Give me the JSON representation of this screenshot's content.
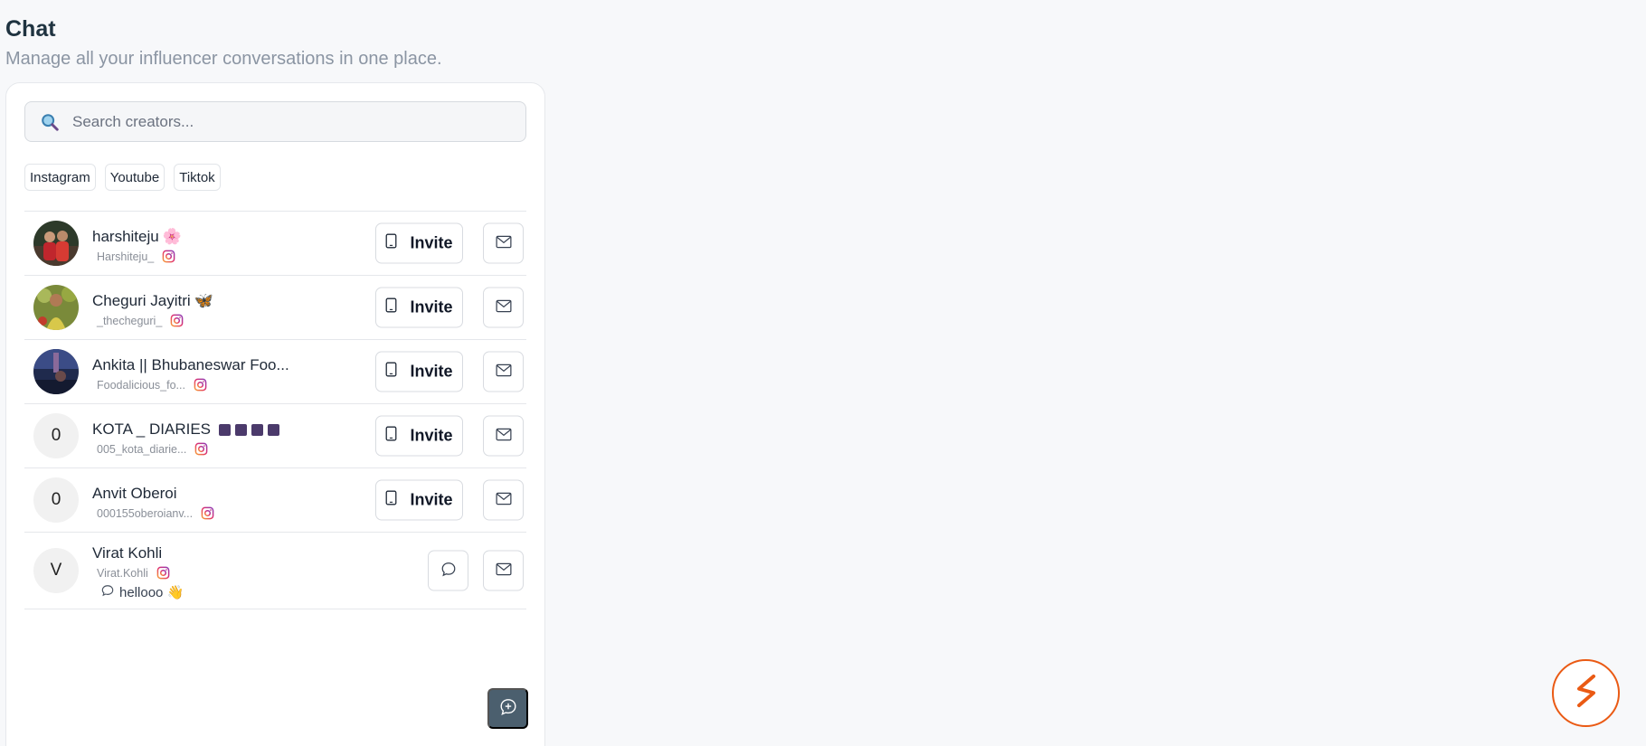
{
  "header": {
    "title": "Chat",
    "subtitle": "Manage all your influencer conversations in one place."
  },
  "search": {
    "placeholder": "Search creators...",
    "icon": "search-icon"
  },
  "filters": [
    "Instagram",
    "Youtube",
    "Tiktok"
  ],
  "creators": [
    {
      "name": "harshiteju",
      "name_emoji": "🌸",
      "handle": "Harshiteju_",
      "platform": "instagram",
      "action": "Invite",
      "avatar": "photo"
    },
    {
      "name": "Cheguri Jayitri",
      "name_emoji": "🦋",
      "handle": "_thecheguri_",
      "platform": "instagram",
      "action": "Invite",
      "avatar": "photo"
    },
    {
      "name": "Ankita || Bhubaneswar Foo...",
      "name_emoji": "",
      "handle": "Foodalicious_fo...",
      "platform": "instagram",
      "action": "Invite",
      "avatar": "photo"
    },
    {
      "name": "KOTA _ DIARIES",
      "name_emoji": "",
      "handle": "005_kota_diarie...",
      "platform": "instagram",
      "action": "Invite",
      "avatar_initial": "0"
    },
    {
      "name": "Anvit Oberoi",
      "name_emoji": "",
      "handle": "000155oberoianv...",
      "platform": "instagram",
      "action": "Invite",
      "avatar_initial": "0"
    },
    {
      "name": "Virat Kohli",
      "name_emoji": "",
      "handle": "Virat.Kohli",
      "platform": "instagram",
      "action": "chat",
      "avatar_initial": "V",
      "last_message": "hellooo 👋"
    }
  ],
  "colors": {
    "accent_dark": "#4b5f6e",
    "brand_orange": "#ea5a14",
    "title": "#1f3340"
  }
}
